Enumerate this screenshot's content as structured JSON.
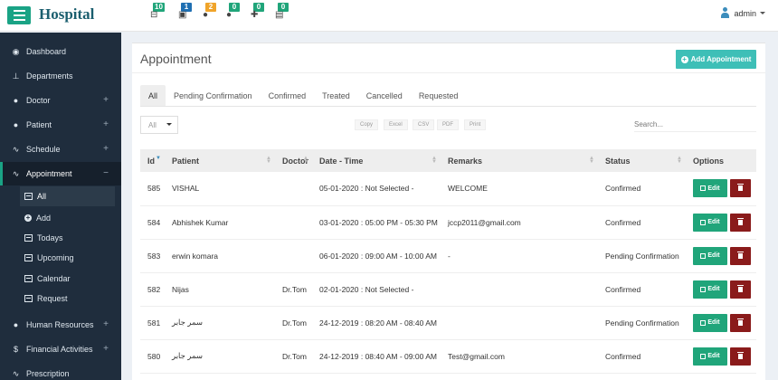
{
  "app": {
    "title": "Hospital",
    "user": "admin"
  },
  "notifications": [
    {
      "name": "beds",
      "count": "10",
      "color": "#20a57a",
      "glyph": "⊟"
    },
    {
      "name": "payments",
      "count": "1",
      "color": "#1f6fb2",
      "glyph": "▣"
    },
    {
      "name": "patients",
      "count": "2",
      "color": "#f0a42a",
      "glyph": "●"
    },
    {
      "name": "doctors",
      "count": "0",
      "color": "#20a57a",
      "glyph": "●"
    },
    {
      "name": "hospital",
      "count": "0",
      "color": "#20a57a",
      "glyph": "✚"
    },
    {
      "name": "reports",
      "count": "0",
      "color": "#20a57a",
      "glyph": "▤"
    }
  ],
  "sidebar": {
    "items": [
      {
        "label": "Dashboard",
        "icon": "dashboard-icon",
        "glyph": "◉",
        "plus": ""
      },
      {
        "label": "Departments",
        "icon": "sitemap-icon",
        "glyph": "⊥",
        "plus": ""
      },
      {
        "label": "Doctor",
        "icon": "users-icon",
        "glyph": "●",
        "plus": "+"
      },
      {
        "label": "Patient",
        "icon": "users-icon",
        "glyph": "●",
        "plus": "+"
      },
      {
        "label": "Schedule",
        "icon": "stethoscope-icon",
        "glyph": "∿",
        "plus": "+"
      },
      {
        "label": "Appointment",
        "icon": "stethoscope-icon",
        "glyph": "∿",
        "plus": "−"
      }
    ],
    "sub_items": [
      {
        "label": "All",
        "icon": "list-icon"
      },
      {
        "label": "Add",
        "icon": "plus-circle-icon"
      },
      {
        "label": "Todays",
        "icon": "list-icon"
      },
      {
        "label": "Upcoming",
        "icon": "list-icon"
      },
      {
        "label": "Calendar",
        "icon": "list-icon"
      },
      {
        "label": "Request",
        "icon": "list-icon"
      }
    ],
    "lower_items": [
      {
        "label": "Human Resources",
        "icon": "users-icon",
        "glyph": "●",
        "plus": "+"
      },
      {
        "label": "Financial Activities",
        "icon": "dollar-icon",
        "glyph": "$",
        "plus": "+"
      },
      {
        "label": "Prescription",
        "icon": "stethoscope-icon",
        "glyph": "∿",
        "plus": ""
      }
    ]
  },
  "page": {
    "title": "Appointment",
    "add_button": "Add Appointment",
    "tabs": [
      "All",
      "Pending Confirmation",
      "Confirmed",
      "Treated",
      "Cancelled",
      "Requested"
    ],
    "length_value": "All",
    "export_buttons": [
      "Copy",
      "Excel",
      "CSV",
      "PDF",
      "Print"
    ],
    "search_placeholder": "Search...",
    "columns": [
      "Id",
      "Patient",
      "Doctor",
      "Date - Time",
      "Remarks",
      "Status",
      "Options"
    ],
    "edit_label": "Edit",
    "rows": [
      {
        "id": "585",
        "patient": "VISHAL",
        "doctor": "",
        "datetime": "05-01-2020 : Not Selected -",
        "remarks": "WELCOME",
        "status": "Confirmed"
      },
      {
        "id": "584",
        "patient": "Abhishek Kumar",
        "doctor": "",
        "datetime": "03-01-2020 : 05:00 PM - 05:30 PM",
        "remarks": "jccp2011@gmail.com",
        "status": "Confirmed"
      },
      {
        "id": "583",
        "patient": "erwin komara",
        "doctor": "",
        "datetime": "06-01-2020 : 09:00 AM - 10:00 AM",
        "remarks": "-",
        "status": "Pending Confirmation"
      },
      {
        "id": "582",
        "patient": "Nijas",
        "doctor": "Dr.Tom",
        "datetime": "02-01-2020 : Not Selected -",
        "remarks": "",
        "status": "Confirmed"
      },
      {
        "id": "581",
        "patient": "سمر جابر",
        "doctor": "Dr.Tom",
        "datetime": "24-12-2019 : 08:20 AM - 08:40 AM",
        "remarks": "",
        "status": "Pending Confirmation"
      },
      {
        "id": "580",
        "patient": "سمر جابر",
        "doctor": "Dr.Tom",
        "datetime": "24-12-2019 : 08:40 AM - 09:00 AM",
        "remarks": "Test@gmail.com",
        "status": "Confirmed"
      }
    ]
  }
}
